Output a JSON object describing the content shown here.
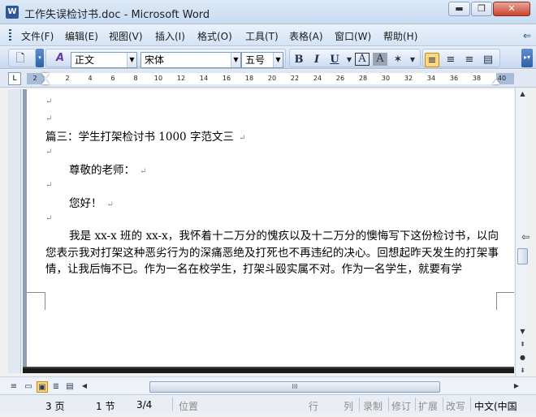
{
  "window": {
    "app_icon": "W",
    "title": "工作失误检讨书.doc - Microsoft Word",
    "min_glyph": "▬",
    "max_glyph": "❐",
    "close_glyph": "✕"
  },
  "menu": {
    "items": [
      "文件(F)",
      "编辑(E)",
      "视图(V)",
      "插入(I)",
      "格式(O)",
      "工具(T)",
      "表格(A)",
      "窗口(W)",
      "帮助(H)"
    ],
    "overflow_glyph": "⇐"
  },
  "toolbar": {
    "style_value": "正文",
    "font_value": "宋体",
    "size_value": "五号",
    "bold": "B",
    "italic": "I",
    "underline": "U",
    "font_a": "A",
    "icons": [
      "new-document-icon",
      "styles-pane-icon",
      "bold-icon",
      "italic-icon",
      "underline-icon",
      "character-border-icon",
      "character-shading-icon",
      "clear-formatting-icon",
      "align-left-icon",
      "center-icon",
      "align-right-icon",
      "justify-icon"
    ]
  },
  "ruler": {
    "ticks": [
      "2",
      "2",
      "4",
      "6",
      "8",
      "10",
      "12",
      "14",
      "16",
      "18",
      "20",
      "22",
      "24",
      "26",
      "28",
      "30",
      "32",
      "34",
      "36",
      "38",
      "40"
    ],
    "tab_selector": "L"
  },
  "document": {
    "paragraph_mark": "↵",
    "heading": "篇三：学生打架检讨书 1000 字范文三",
    "salutation": "尊敬的老师：",
    "greeting": "您好！",
    "body": "我是 xx-x 班的 xx-x，我怀着十二万分的愧疚以及十二万分的懊悔写下这份检讨书，以向您表示我对打架这种恶劣行为的深痛恶绝及打死也不再违纪的决心。回想起昨天发生的打架事情，让我后悔不已。作为一名在校学生，打架斗殴实属不对。作为一名学生，就要有学"
  },
  "scrollbar": {
    "up": "▲",
    "down": "▼",
    "left": "◀",
    "right": "▶",
    "prev_page": "⇞",
    "browse_object": "●",
    "next_page": "⇟",
    "thumb_grip": "III",
    "split_glyph": "⇦"
  },
  "views": [
    "≡",
    "▭",
    "▣",
    "≣",
    "▤"
  ],
  "status": {
    "page": "3 页",
    "section": "1 节",
    "page_of": "3/4",
    "position": "位置",
    "line": "行",
    "column": "列",
    "record": "录制",
    "revise": "修订",
    "extend": "扩展",
    "overtype": "改写",
    "language": "中文(中国"
  },
  "colors": {
    "titlebar": "#c9dcf2",
    "toolbar": "#d4e3f5",
    "active_button": "#fbd87c",
    "doc_background": "#8f9fb3"
  }
}
